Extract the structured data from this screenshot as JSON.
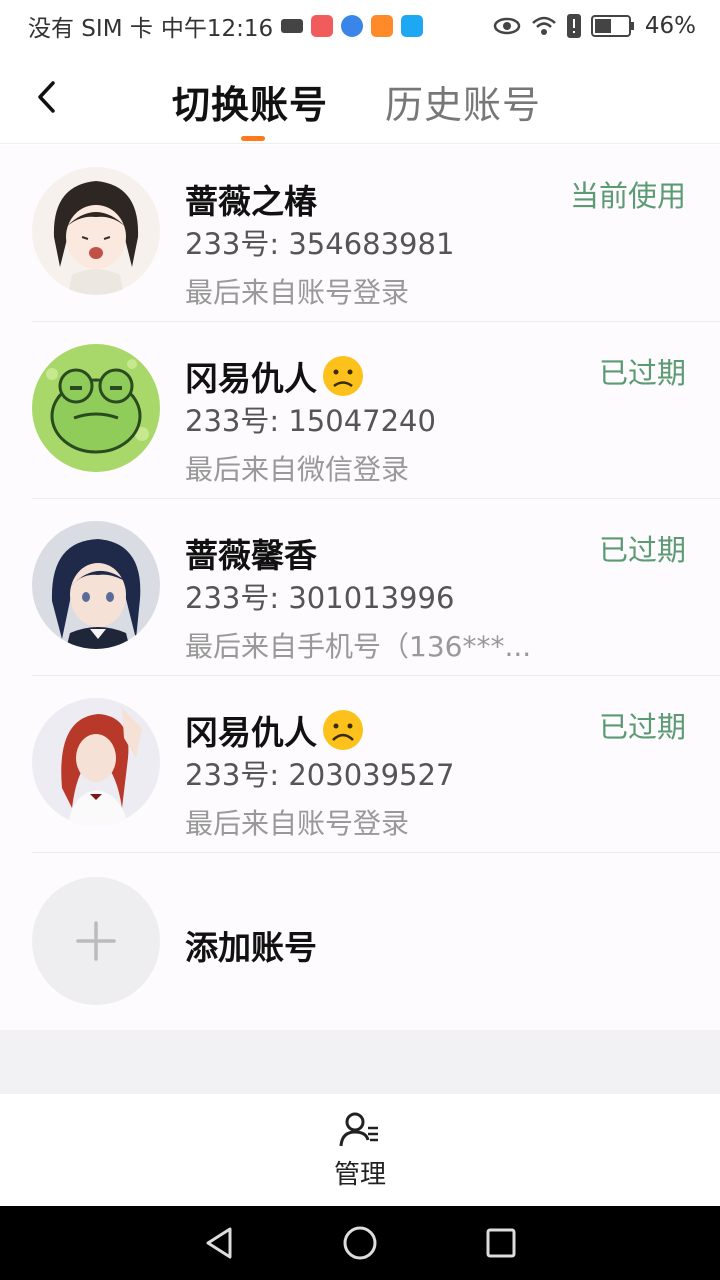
{
  "status": {
    "carrier": "没有 SIM 卡",
    "time": "中午12:16",
    "battery": "46%"
  },
  "header": {
    "tab_switch": "切换账号",
    "tab_history": "历史账号"
  },
  "accounts": [
    {
      "name": "蔷薇之椿",
      "uid": "233号: 354683981",
      "last": "最后来自账号登录",
      "state": "当前使用",
      "emoji": ""
    },
    {
      "name": "冈易仇人",
      "uid": "233号: 15047240",
      "last": "最后来自微信登录",
      "state": "已过期",
      "emoji": "sad-face"
    },
    {
      "name": "蔷薇馨香",
      "uid": "233号: 301013996",
      "last": "最后来自手机号（136***...",
      "state": "已过期",
      "emoji": ""
    },
    {
      "name": "冈易仇人",
      "uid": "233号: 203039527",
      "last": "最后来自账号登录",
      "state": "已过期",
      "emoji": "sad-face"
    }
  ],
  "add_account": "添加账号",
  "bottom": {
    "manage": "管理"
  },
  "colors": {
    "accent": "#ff7a1a",
    "status_green": "#5c9a74"
  }
}
